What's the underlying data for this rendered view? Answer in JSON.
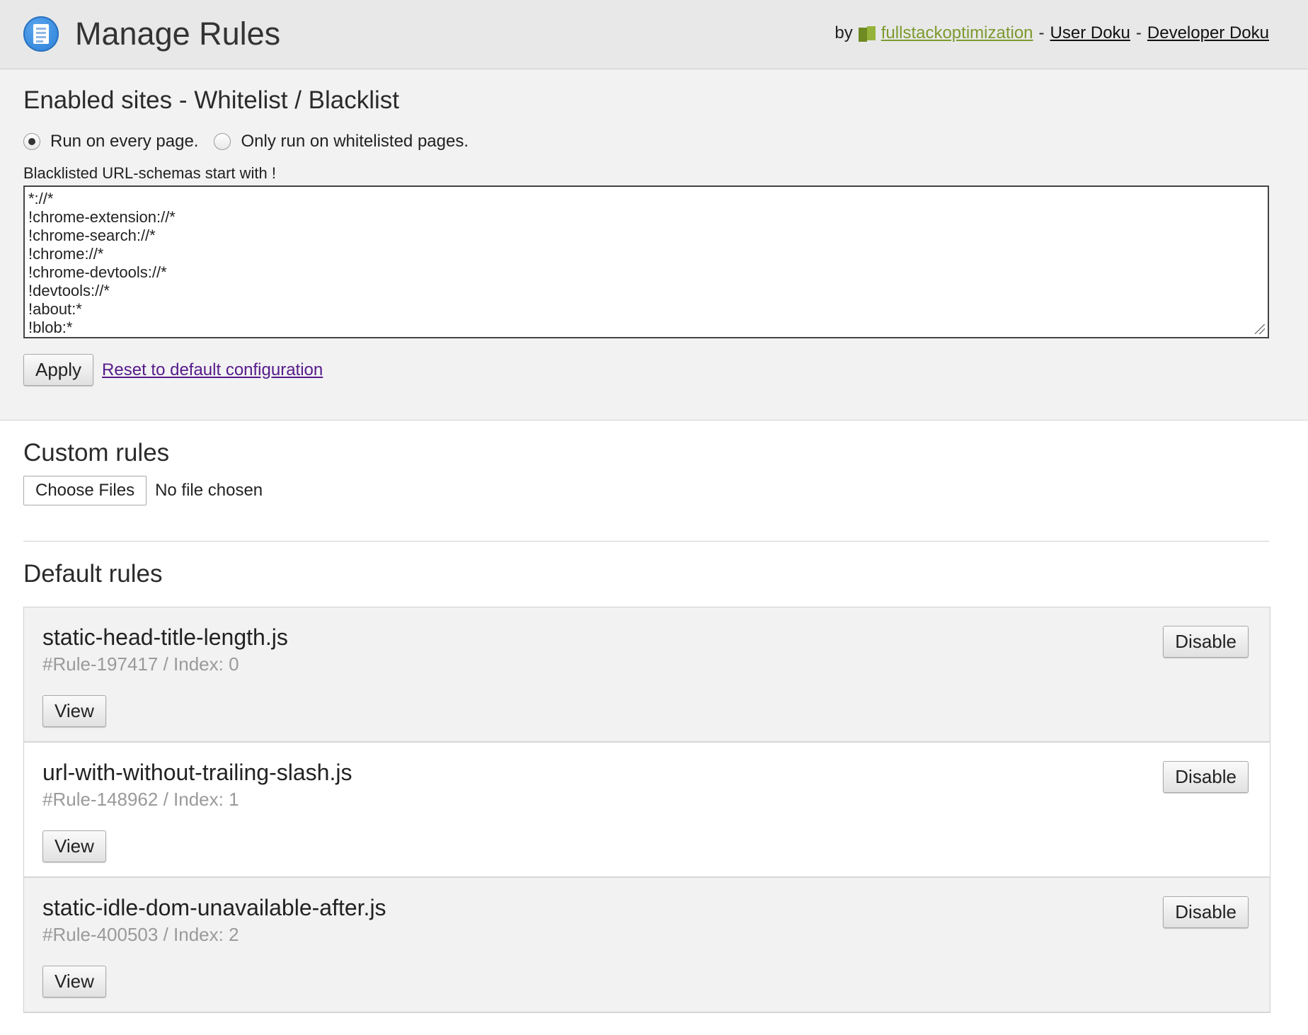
{
  "header": {
    "title": "Manage Rules",
    "by_label": "by",
    "brand_link": "fullstackoptimization",
    "separator1": "-",
    "user_doc_link": "User Doku",
    "separator2": "-",
    "dev_doc_link": "Developer Doku",
    "brand_color": "#7c9a2e"
  },
  "enabled_sites": {
    "heading": "Enabled sites - Whitelist / Blacklist",
    "options": [
      {
        "label": "Run on every page.",
        "checked": true
      },
      {
        "label": "Only run on whitelisted pages.",
        "checked": false
      }
    ],
    "textarea_label": "Blacklisted URL-schemas start with !",
    "textarea_lines": [
      "*://*",
      "!chrome-extension://*",
      "!chrome-search://*",
      "!chrome://*",
      "!chrome-devtools://*",
      "!devtools://*",
      "!about:*",
      "!blob:*"
    ],
    "apply_label": "Apply",
    "reset_link": "Reset to default configuration"
  },
  "custom_rules": {
    "heading": "Custom rules",
    "choose_files_label": "Choose Files",
    "file_status": "No file chosen"
  },
  "default_rules": {
    "heading": "Default rules",
    "items": [
      {
        "name": "static-head-title-length.js",
        "meta": "#Rule-197417 / Index: 0",
        "disable_label": "Disable",
        "view_label": "View"
      },
      {
        "name": "url-with-without-trailing-slash.js",
        "meta": "#Rule-148962 / Index: 1",
        "disable_label": "Disable",
        "view_label": "View"
      },
      {
        "name": "static-idle-dom-unavailable-after.js",
        "meta": "#Rule-400503 / Index: 2",
        "disable_label": "Disable",
        "view_label": "View"
      }
    ]
  }
}
